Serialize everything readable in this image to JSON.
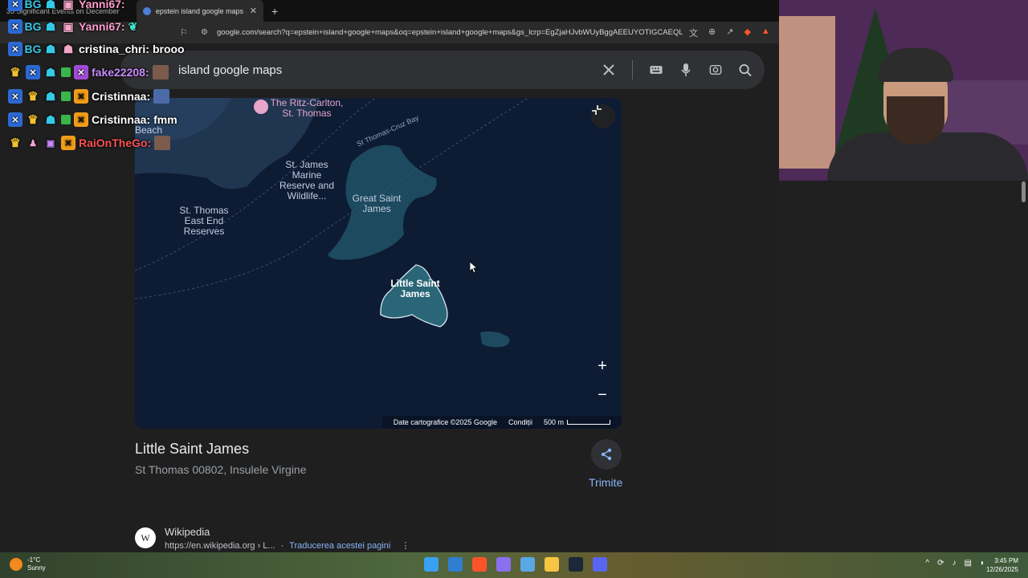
{
  "browser": {
    "tabs": [
      {
        "label": "35 Significant Events on December",
        "active": false
      },
      {
        "label": "epstein island google maps - Căutare",
        "active": true
      }
    ],
    "url": "google.com/search?q=epstein+island+google+maps&oq=epstein+island+google+maps&gs_lcrp=EgZjaHJvbWUyBggAEEUYOTIGCAEQL..."
  },
  "search": {
    "query": "epstein island google maps",
    "visible_query": "island google maps"
  },
  "map": {
    "labels": {
      "ritz": "The Ritz-Carlton, St. Thomas",
      "beach": "Beach",
      "cruz_bay": "St Thomas-Cruz Bay",
      "marine_reserve": "St. James Marine Reserve and Wildlife...",
      "great_saint_james": "Great Saint James",
      "east_end": "St. Thomas East End Reserves",
      "little_saint_james": "Little Saint James"
    },
    "footer": {
      "copyright": "Date cartografice ©2025 Google",
      "terms": "Condiții",
      "scale": "500 m"
    }
  },
  "place": {
    "title": "Little Saint James",
    "address": "St Thomas 00802, Insulele Virgine",
    "share_label": "Trimite"
  },
  "result": {
    "favicon": "W",
    "site": "Wikipedia",
    "url": "https://en.wikipedia.org › L...",
    "translate": "Traducerea acestei pagini"
  },
  "chat": [
    {
      "name": "Yanni67:",
      "message": "",
      "color": "pink"
    },
    {
      "name": "Yanni67:",
      "message": "",
      "color": "pink"
    },
    {
      "name": "cristina_chri:",
      "message": "brooo",
      "color": "white"
    },
    {
      "name": "fake22208:",
      "message": "",
      "color": "purple"
    },
    {
      "name": "Cristinnaa:",
      "message": "",
      "color": "white"
    },
    {
      "name": "Cristinnaa:",
      "message": "fmm",
      "color": "white"
    },
    {
      "name": "RaiOnTheGo:",
      "message": "",
      "color": "red"
    }
  ],
  "taskbar": {
    "temperature": "-1°C",
    "weather": "Sunny",
    "time": "3:45 PM",
    "date": "12/26/2025"
  }
}
